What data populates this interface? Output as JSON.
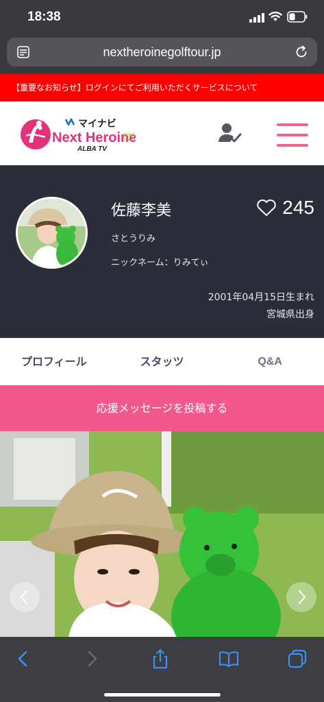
{
  "status_bar": {
    "time": "18:38"
  },
  "browser": {
    "url": "nextheroinegolftour.jp"
  },
  "notice": {
    "text": "【重要なお知らせ】ログインにてご利用いただくサービスについて"
  },
  "header": {
    "logo": {
      "brand": "マイナビ",
      "title": "Next Heroine",
      "golf": "GOLF",
      "tour": "TOUR",
      "sponsor": "ALBA TV"
    },
    "user_icon": "user-check-icon",
    "menu_icon": "hamburger-menu-icon",
    "accent_color": "#f0648a"
  },
  "profile": {
    "name": "佐藤李美",
    "kana": "さとうりみ",
    "nickname": "ニックネーム：りみてぃ",
    "likes": "245",
    "birthdate": "2001年04月15日生まれ",
    "hometown": "宮城県出身",
    "background_color": "#2b2d38"
  },
  "tabs": [
    {
      "label": "プロフィール"
    },
    {
      "label": "スタッツ"
    },
    {
      "label": "Q&A"
    }
  ],
  "cta": {
    "label": "応援メッセージを投稿する",
    "color": "#f2588a"
  },
  "notice_color": "#ff0000"
}
